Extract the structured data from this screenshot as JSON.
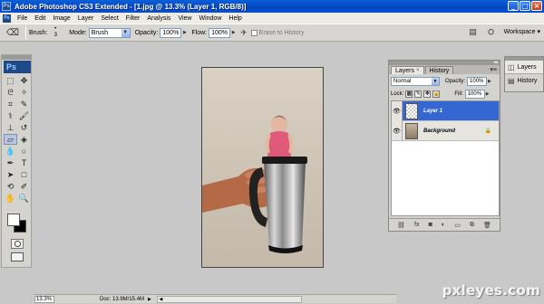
{
  "window": {
    "title": "Adobe Photoshop CS3 Extended - [1.jpg @ 13.3% (Layer 1, RGB/8)]",
    "app_badge": "Ps",
    "buttons": {
      "minimize": "_",
      "maximize": "□",
      "close": "×"
    }
  },
  "menu": {
    "items": [
      "File",
      "Edit",
      "Image",
      "Layer",
      "Select",
      "Filter",
      "Analysis",
      "View",
      "Window",
      "Help"
    ]
  },
  "options": {
    "brush_label": "Brush:",
    "brush_size": "3",
    "mode_label": "Mode:",
    "mode_value": "Brush",
    "opacity_label": "Opacity:",
    "opacity_value": "100%",
    "flow_label": "Flow:",
    "flow_value": "100%",
    "erase_history_label": "Erase to History",
    "workspace_label": "Workspace ▾"
  },
  "toolbox": {
    "logo": "Ps",
    "tools": [
      {
        "name": "move-tool-icon",
        "glyph": "✥"
      },
      {
        "name": "marquee-tool-icon",
        "glyph": "⬚"
      },
      {
        "name": "lasso-tool-icon",
        "glyph": "ᘓ"
      },
      {
        "name": "magic-wand-tool-icon",
        "glyph": "✧"
      },
      {
        "name": "crop-tool-icon",
        "glyph": "⌗"
      },
      {
        "name": "eyedropper-tool-icon",
        "glyph": "✎"
      },
      {
        "name": "healing-brush-tool-icon",
        "glyph": "⚕"
      },
      {
        "name": "brush-tool-icon",
        "glyph": "🖌"
      },
      {
        "name": "clone-stamp-tool-icon",
        "glyph": "⊥"
      },
      {
        "name": "history-brush-tool-icon",
        "glyph": "↺"
      },
      {
        "name": "eraser-tool-icon",
        "glyph": "▱",
        "active": true
      },
      {
        "name": "paint-bucket-tool-icon",
        "glyph": "◈"
      },
      {
        "name": "blur-tool-icon",
        "glyph": "💧"
      },
      {
        "name": "dodge-tool-icon",
        "glyph": "○"
      },
      {
        "name": "pen-tool-icon",
        "glyph": "✒"
      },
      {
        "name": "type-tool-icon",
        "glyph": "T"
      },
      {
        "name": "path-selection-tool-icon",
        "glyph": "➤"
      },
      {
        "name": "shape-tool-icon",
        "glyph": "□"
      },
      {
        "name": "3d-rotate-tool-icon",
        "glyph": "⟲"
      },
      {
        "name": "notes-tool-icon",
        "glyph": "✐"
      },
      {
        "name": "hand-tool-icon",
        "glyph": "✋"
      },
      {
        "name": "zoom-tool-icon",
        "glyph": "🔍"
      }
    ]
  },
  "layers_panel": {
    "tabs": [
      {
        "label": "Layers",
        "close": "×",
        "active": true
      },
      {
        "label": "History",
        "active": false
      }
    ],
    "blend_mode": "Normal",
    "opacity_label": "Opacity:",
    "opacity_value": "100%",
    "lock_label": "Lock:",
    "fill_label": "Fill:",
    "fill_value": "100%",
    "layers": [
      {
        "name": "Layer 1",
        "selected": true
      },
      {
        "name": "Background",
        "selected": false,
        "locked": true
      }
    ],
    "bottom_icons": [
      "link-icon",
      "fx-icon",
      "mask-icon",
      "adjustment-icon",
      "group-icon",
      "new-layer-icon",
      "trash-icon"
    ],
    "bottom_glyphs": [
      "⛓",
      "fx",
      "◙",
      "◐",
      "▭",
      "⧉",
      "🗑"
    ]
  },
  "dock": {
    "items": [
      {
        "label": "Layers",
        "icon": "layers-icon"
      },
      {
        "label": "History",
        "icon": "history-icon"
      }
    ]
  },
  "status": {
    "zoom": "13.3%",
    "doc": "Doc: 13.9M/15.4M"
  },
  "canvas": {
    "image_description_label": ""
  },
  "watermark": "pxleyes.com",
  "colors": {
    "titlebar": "#0a5fd8",
    "selected_layer": "#3467d2",
    "workspace_bg": "#c8c8c8"
  }
}
